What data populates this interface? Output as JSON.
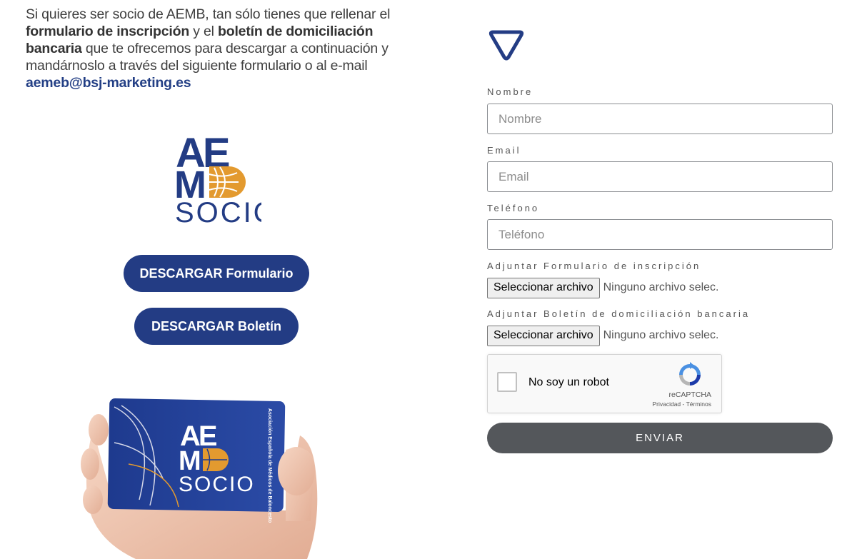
{
  "intro": {
    "part1": "Si quieres ser socio de AEMB, tan sólo tienes que rellenar el ",
    "bold1": "formulario de inscripción",
    "part2": " y el ",
    "bold2": "boletín de domiciliación bancaria",
    "part3": " que te ofrecemos para descargar a continuación y mandárnoslo a través del siguiente formulario o al e-mail ",
    "email": "aemeb@bsj-marketing.es"
  },
  "logo": {
    "line1": "AE",
    "line2": "M",
    "line3": "SOCIO",
    "icon": "basketball-icon"
  },
  "buttons": {
    "download_form": "DESCARGAR Formulario",
    "download_bulletin": "DESCARGAR Boletín"
  },
  "card": {
    "line1": "AE",
    "line2": "M",
    "line3": "SOCIO",
    "side_text": "Asociación Española de Médicos de Baloncesto"
  },
  "form": {
    "name_label": "Nombre",
    "name_placeholder": "Nombre",
    "email_label": "Email",
    "email_placeholder": "Email",
    "phone_label": "Teléfono",
    "phone_placeholder": "Teléfono",
    "attach_form_label": "Adjuntar Formulario de inscripción",
    "attach_bulletin_label": "Adjuntar Boletín de domiciliación bancaria",
    "file_button": "Seleccionar archivo",
    "file_none": "Ninguno archivo selec.",
    "submit": "ENVIAR"
  },
  "captcha": {
    "text": "No soy un robot",
    "brand": "reCAPTCHA",
    "privacy": "Privacidad",
    "separator": " - ",
    "terms": "Términos"
  },
  "colors": {
    "brand_blue": "#233c84",
    "brand_orange": "#e39a2f",
    "submit_gray": "#54575b"
  }
}
